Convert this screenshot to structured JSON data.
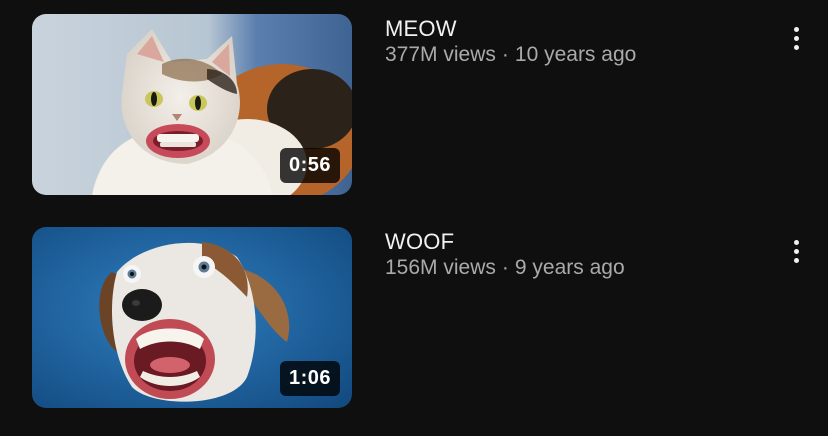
{
  "videos": [
    {
      "title": "MEOW",
      "views": "377M views",
      "separator": "·",
      "age": "10 years ago",
      "duration": "0:56",
      "thumbnail": "cat-with-human-mouth-thumbnail",
      "menu_icon": "more-vert-icon"
    },
    {
      "title": "WOOF",
      "views": "156M views",
      "separator": "·",
      "age": "9 years ago",
      "duration": "1:06",
      "thumbnail": "dog-with-human-mouth-thumbnail",
      "menu_icon": "more-vert-icon"
    }
  ],
  "colors": {
    "background": "#0f0f0f",
    "title": "#f1f1f1",
    "secondary_text": "#aaaaaa",
    "duration_badge": "#000000"
  }
}
